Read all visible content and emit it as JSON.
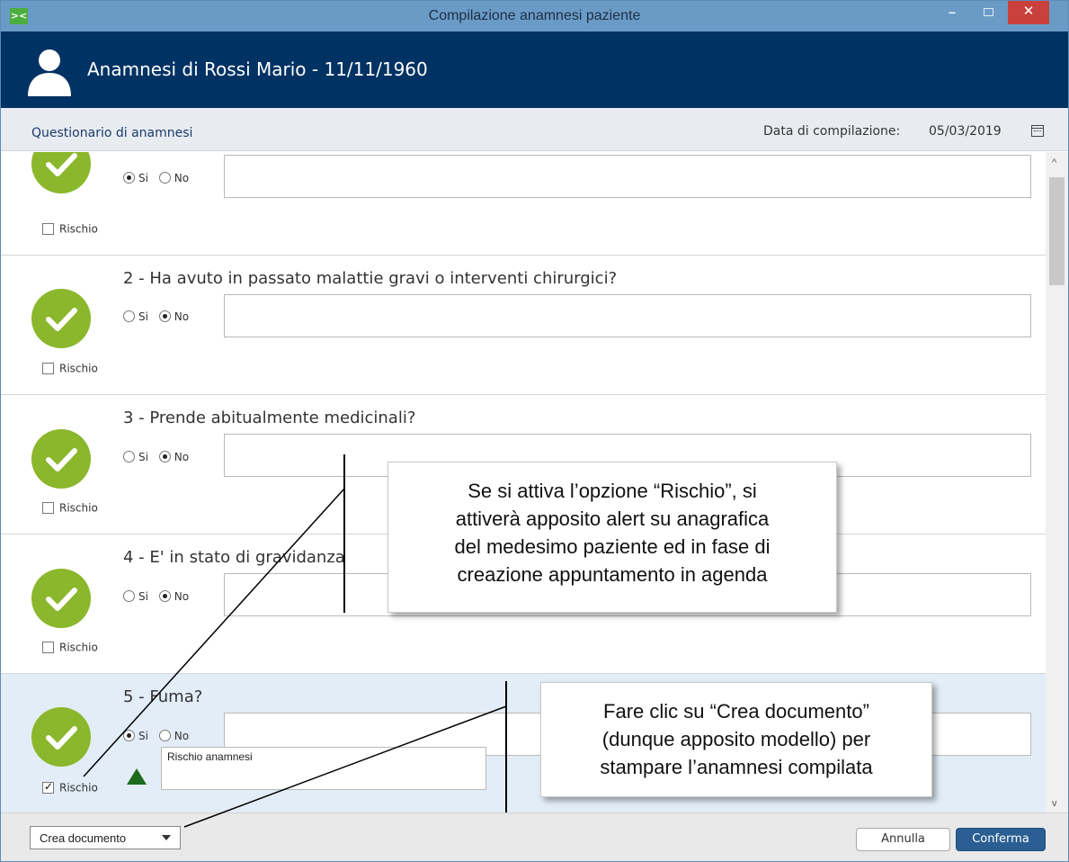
{
  "window": {
    "title": "Compilazione anamnesi paziente",
    "minimize_label": "–",
    "close_label": "✕",
    "app_icon_label": "><"
  },
  "header": {
    "title": "Anamnesi di  Rossi Mario - 11/11/1960"
  },
  "subheader": {
    "section_title": "Questionario di anamnesi",
    "date_label": "Data di compilazione:",
    "date_value": "05/03/2019"
  },
  "questions": [
    {
      "number_title": "",
      "si_label": "Si",
      "no_label": "No",
      "selected": "Si",
      "answer": "",
      "risk_label": "Rischio",
      "risk_checked": false
    },
    {
      "number_title": "2 - Ha avuto in passato malattie gravi o interventi chirurgici?",
      "si_label": "Si",
      "no_label": "No",
      "selected": "No",
      "answer": "",
      "risk_label": "Rischio",
      "risk_checked": false
    },
    {
      "number_title": "3 - Prende abitualmente medicinali?",
      "si_label": "Si",
      "no_label": "No",
      "selected": "No",
      "answer": "",
      "risk_label": "Rischio",
      "risk_checked": false
    },
    {
      "number_title": "4 - E' in stato di gravidanza",
      "si_label": "Si",
      "no_label": "No",
      "selected": "No",
      "answer": "",
      "risk_label": "Rischio",
      "risk_checked": false
    },
    {
      "number_title": "5 - Fuma?",
      "si_label": "Si",
      "no_label": "No",
      "selected": "Si",
      "answer": "",
      "risk_label": "Rischio",
      "risk_checked": true,
      "risk_note": "Rischio anamnesi"
    }
  ],
  "footer": {
    "create_document_label": "Crea documento",
    "cancel_label": "Annulla",
    "confirm_label": "Conferma"
  },
  "callouts": {
    "risk_option": [
      "Se si attiva l’opzione “Rischio”, si",
      "attiverà apposito alert su anagrafica",
      "del medesimo paziente ed in fase di",
      "creazione appuntamento in agenda"
    ],
    "create_document": [
      "Fare clic su “Crea documento”",
      "(dunque apposito modello) per",
      "stampare l’anamnesi compilata"
    ]
  },
  "colors": {
    "title_bar": "#6a9bc6",
    "header": "#003263",
    "check_green": "#8ab72b",
    "risk_triangle": "#1c6b1c",
    "confirm_button": "#2b5f93",
    "close_button": "#c9403c"
  },
  "icons": [
    "app-icon",
    "person-icon",
    "calendar-icon",
    "check-icon",
    "warning-triangle-icon",
    "chevron-down-icon",
    "scroll-up-icon",
    "scroll-down-icon"
  ]
}
